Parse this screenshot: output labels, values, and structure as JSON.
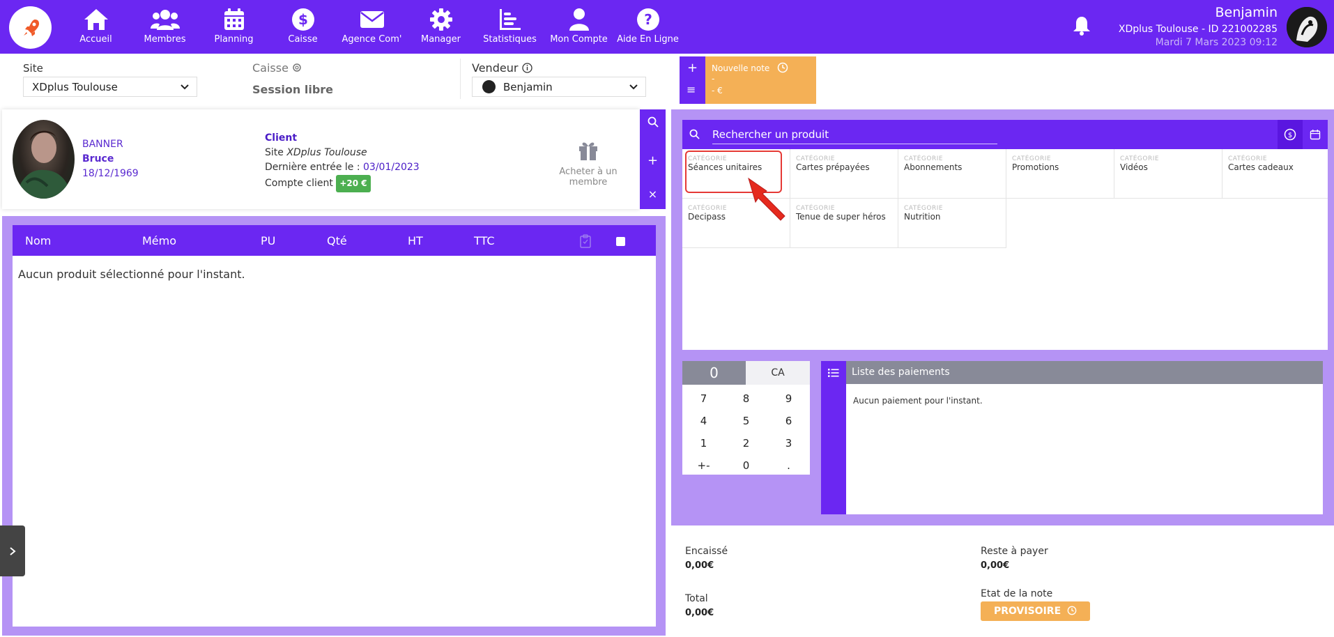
{
  "nav": {
    "items": [
      {
        "label": "Accueil",
        "icon": "home-icon"
      },
      {
        "label": "Membres",
        "icon": "users-icon"
      },
      {
        "label": "Planning",
        "icon": "calendar-icon"
      },
      {
        "label": "Caisse",
        "icon": "dollar-icon"
      },
      {
        "label": "Agence Com'",
        "icon": "envelope-icon"
      },
      {
        "label": "Manager",
        "icon": "gear-icon"
      },
      {
        "label": "Statistiques",
        "icon": "chart-icon"
      },
      {
        "label": "Mon Compte",
        "icon": "user-icon"
      },
      {
        "label": "Aide En Ligne",
        "icon": "help-icon"
      }
    ]
  },
  "user": {
    "name": "Benjamin",
    "site": "XDplus Toulouse - ID 221002285",
    "date": "Mardi 7 Mars 2023 09:12"
  },
  "fields": {
    "site_label": "Site",
    "site_value": "XDplus Toulouse",
    "caisse_label": "Caisse",
    "session": "Session libre",
    "vendeur_label": "Vendeur",
    "vendeur_value": "Benjamin"
  },
  "note": {
    "title": "Nouvelle note",
    "line2": "-",
    "line3": "- €",
    "plus": "+",
    "menu": "≡"
  },
  "client": {
    "last_name": "BANNER",
    "first_name": "Bruce",
    "dob": "18/12/1969",
    "title": "Client",
    "site_prefix": "Site ",
    "site_name": "XDplus Toulouse",
    "last_entry_prefix": "Dernière entrée le : ",
    "last_entry_date": "03/01/2023",
    "account_label": "Compte client ",
    "account_badge": "+20 €",
    "gift_label": "Acheter à un membre"
  },
  "table": {
    "headers": {
      "nom": "Nom",
      "memo": "Mémo",
      "pu": "PU",
      "qte": "Qté",
      "ht": "HT",
      "ttc": "TTC"
    },
    "empty": "Aucun produit sélectionné pour l'instant."
  },
  "search": {
    "placeholder": "Rechercher un produit"
  },
  "categories": [
    {
      "kind": "CATÉGORIE",
      "name": "Séances unitaires"
    },
    {
      "kind": "CATÉGORIE",
      "name": "Cartes prépayées"
    },
    {
      "kind": "CATÉGORIE",
      "name": "Abonnements"
    },
    {
      "kind": "CATÉGORIE",
      "name": "Promotions"
    },
    {
      "kind": "CATÉGORIE",
      "name": "Vidéos"
    },
    {
      "kind": "CATÉGORIE",
      "name": "Cartes cadeaux"
    },
    {
      "kind": "CATÉGORIE",
      "name": "Decipass"
    },
    {
      "kind": "CATÉGORIE",
      "name": "Tenue de super héros"
    },
    {
      "kind": "CATÉGORIE",
      "name": "Nutrition"
    }
  ],
  "keypad": {
    "display": "0",
    "ca": "CA",
    "keys": [
      "7",
      "8",
      "9",
      "4",
      "5",
      "6",
      "1",
      "2",
      "3",
      "+-",
      "0",
      "."
    ]
  },
  "payments": {
    "title": "Liste des paiements",
    "empty": "Aucun paiement pour l'instant."
  },
  "summary": {
    "encaisse_label": "Encaissé",
    "encaisse_value": "0,00€",
    "reste_label": "Reste à payer",
    "reste_value": "0,00€",
    "total_label": "Total",
    "total_value": "0,00€",
    "etat_label": "Etat de la note",
    "etat_value": "PROVISOIRE"
  },
  "colors": {
    "primary": "#6b27f2",
    "panel": "#b593f5",
    "accent_orange": "#f4b056",
    "badge_green": "#4caf50",
    "highlight_red": "#e53935"
  }
}
